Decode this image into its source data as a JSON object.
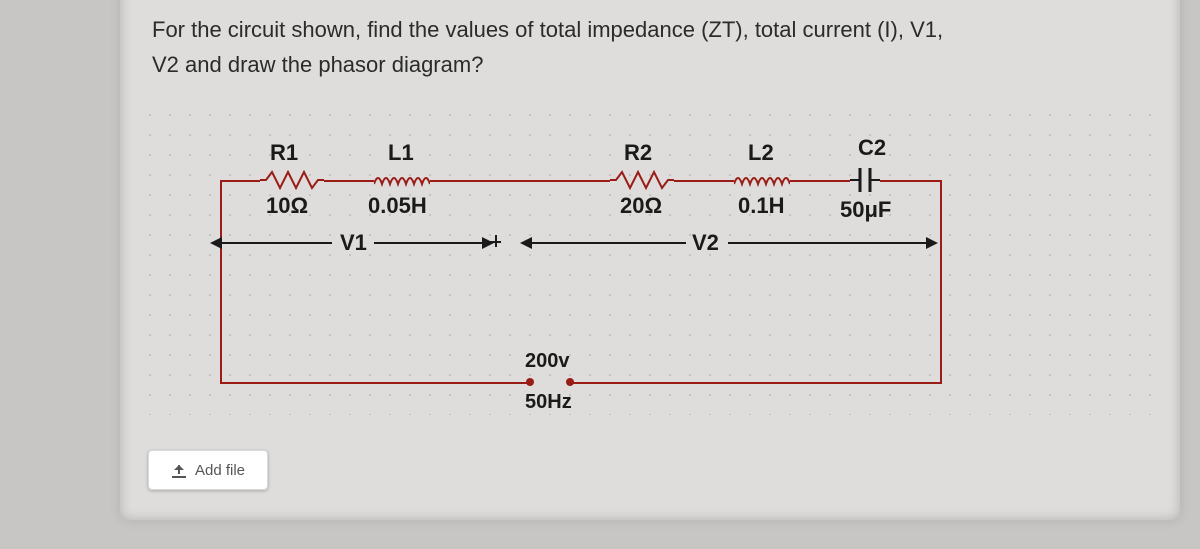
{
  "question": {
    "line1": "For the circuit shown, find the values of total impedance (ZT), total current (I), V1,",
    "line2": "V2 and draw the phasor diagram?"
  },
  "components": {
    "R1": {
      "name": "R1",
      "value": "10Ω"
    },
    "L1": {
      "name": "L1",
      "value": "0.05H"
    },
    "R2": {
      "name": "R2",
      "value": "20Ω"
    },
    "L2": {
      "name": "L2",
      "value": "0.1H"
    },
    "C2": {
      "name": "C2",
      "value": "50μF"
    }
  },
  "voltages": {
    "V1": "V1",
    "V2": "V2"
  },
  "source": {
    "voltage": "200v",
    "frequency": "50Hz"
  },
  "add_file_label": "Add file"
}
